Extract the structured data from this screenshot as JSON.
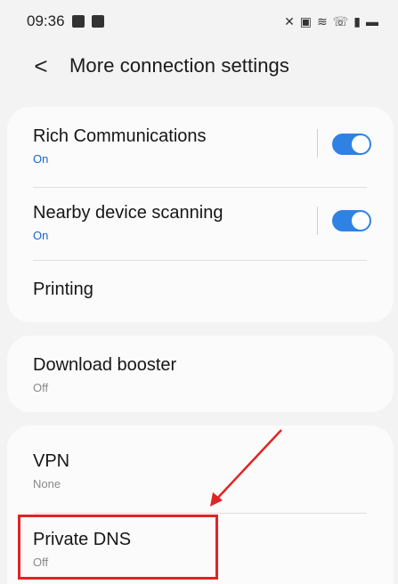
{
  "status_bar": {
    "time": "09:36",
    "left_icons": [
      "gallery-notification-icon",
      "checkbox-notification-icon"
    ],
    "right_icons": [
      "mute-icon",
      "lock-icon",
      "wifi-icon",
      "wifi-calling-icon",
      "signal-icon",
      "battery-icon"
    ]
  },
  "header": {
    "back_glyph": "<",
    "title": "More connection settings"
  },
  "group1": {
    "rich_communications": {
      "title": "Rich Communications",
      "status": "On",
      "toggle_on": true
    },
    "nearby_device_scanning": {
      "title": "Nearby device scanning",
      "status": "On",
      "toggle_on": true
    },
    "printing": {
      "title": "Printing"
    }
  },
  "group2": {
    "download_booster": {
      "title": "Download booster",
      "status": "Off"
    }
  },
  "group3": {
    "vpn": {
      "title": "VPN",
      "status": "None"
    },
    "private_dns": {
      "title": "Private DNS",
      "status": "Off"
    }
  },
  "colors": {
    "accent_blue": "#2f82e4",
    "status_on_blue": "#1766c7",
    "annotation_red": "#e02424",
    "background": "#f3f3f3",
    "card": "#fbfbfb"
  }
}
